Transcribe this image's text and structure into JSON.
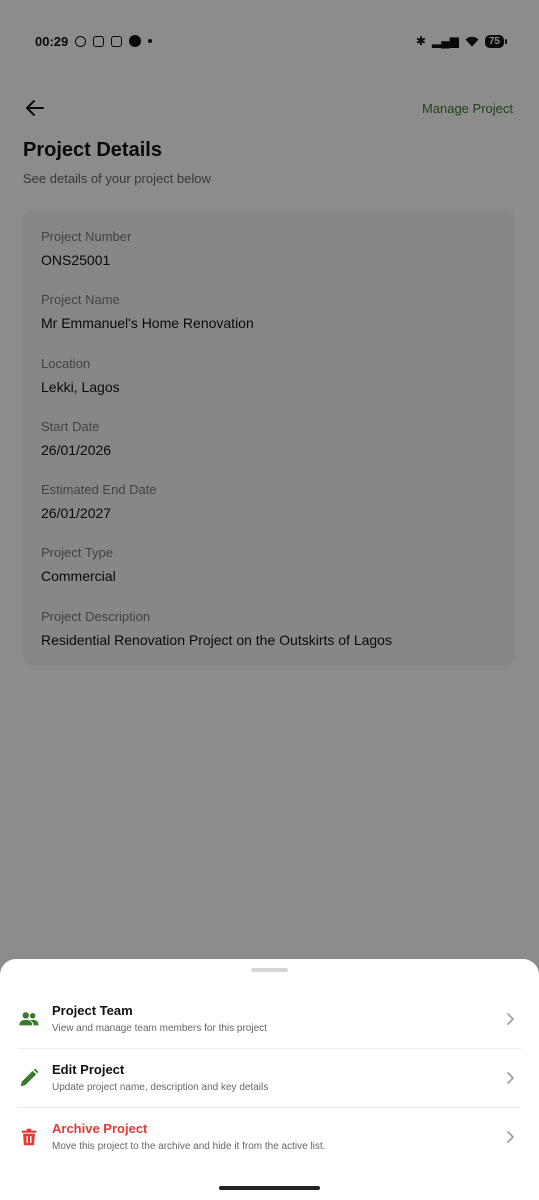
{
  "status": {
    "time": "00:29",
    "battery": "75"
  },
  "header": {
    "manage_label": "Manage Project",
    "title": "Project Details",
    "subtitle": "See details of your project below"
  },
  "details": [
    {
      "label": "Project Number",
      "value": "ONS25001"
    },
    {
      "label": "Project Name",
      "value": "Mr Emmanuel's Home Renovation"
    },
    {
      "label": "Location",
      "value": "Lekki, Lagos"
    },
    {
      "label": "Start Date",
      "value": "26/01/2026"
    },
    {
      "label": "Estimated End Date",
      "value": "26/01/2027"
    },
    {
      "label": "Project Type",
      "value": "Commercial"
    },
    {
      "label": "Project Description",
      "value": "Residential Renovation Project on the Outskirts of Lagos"
    }
  ],
  "sheet": {
    "options": [
      {
        "title": "Project Team",
        "desc": "View and manage team members for this project",
        "icon": "team-icon"
      },
      {
        "title": "Edit Project",
        "desc": "Update project name, description and key details",
        "icon": "pencil-icon"
      },
      {
        "title": "Archive Project",
        "desc": "Move this project to the archive and hide it from the active list.",
        "icon": "trash-icon"
      }
    ]
  },
  "colors": {
    "accent": "#3c7a2b",
    "danger": "#e53935"
  }
}
